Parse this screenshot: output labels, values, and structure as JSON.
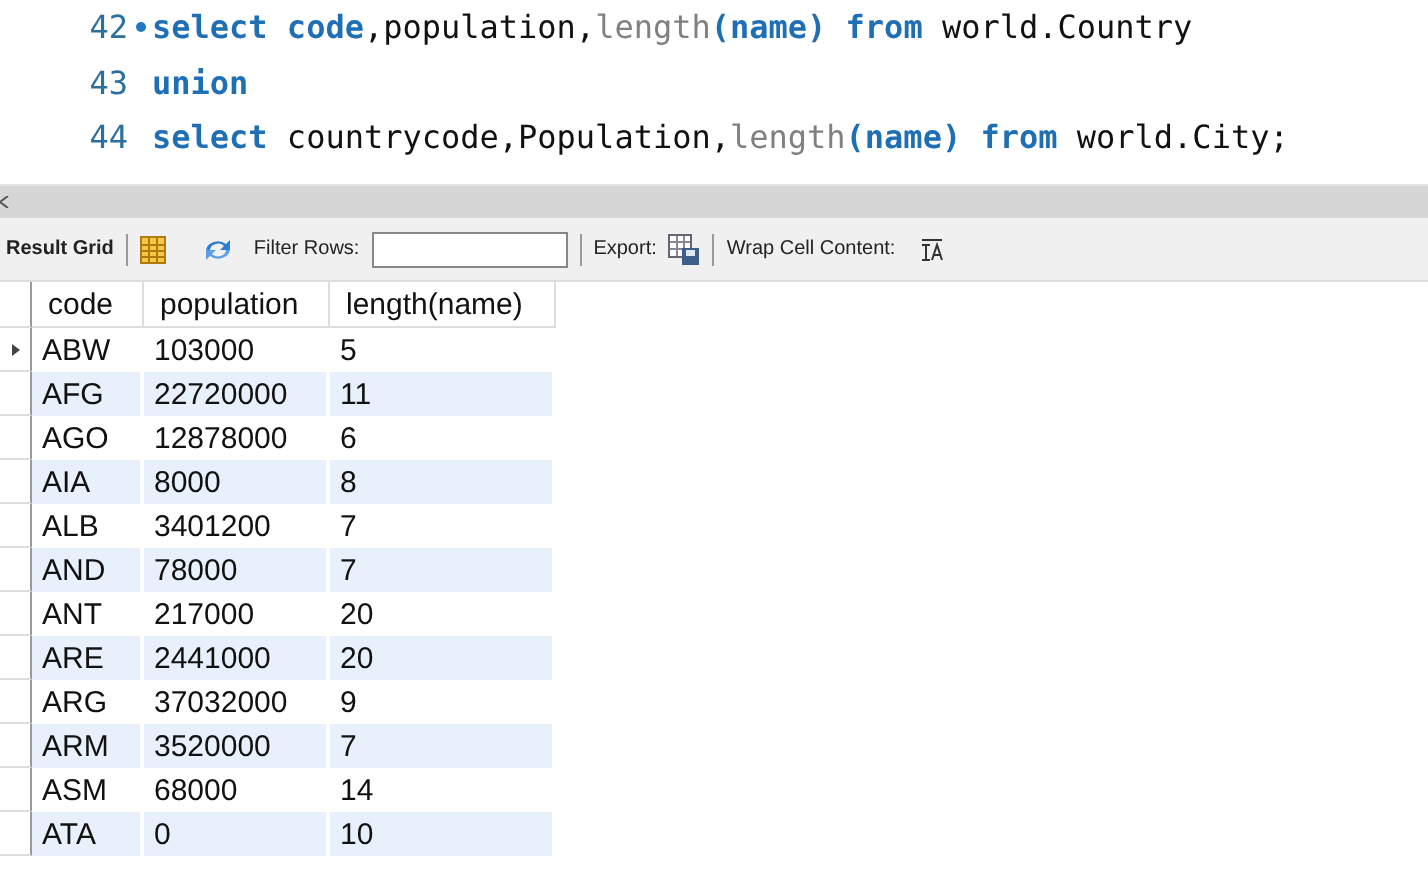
{
  "editor": {
    "lines": [
      {
        "number": "42",
        "marker": true,
        "tokens": [
          {
            "kind": "keyword",
            "text": "select code"
          },
          {
            "kind": "plain",
            "text": ",population,"
          },
          {
            "kind": "function",
            "text": "length"
          },
          {
            "kind": "keyword",
            "text": "(name) from"
          },
          {
            "kind": "plain",
            "text": " world.Country"
          }
        ]
      },
      {
        "number": "43",
        "marker": false,
        "tokens": [
          {
            "kind": "keyword",
            "text": "union"
          }
        ]
      },
      {
        "number": "44",
        "marker": false,
        "tokens": [
          {
            "kind": "keyword",
            "text": "select"
          },
          {
            "kind": "plain",
            "text": " countrycode,Population,"
          },
          {
            "kind": "function",
            "text": "length"
          },
          {
            "kind": "keyword",
            "text": "(name) from"
          },
          {
            "kind": "plain",
            "text": " world.City;"
          }
        ]
      }
    ]
  },
  "toolbar": {
    "result_grid": "Result Grid",
    "filter_label": "Filter Rows:",
    "export_label": "Export:",
    "wrap_label": "Wrap Cell Content:"
  },
  "table": {
    "columns": [
      "code",
      "population",
      "length(name)"
    ],
    "rows": [
      {
        "current": true,
        "cells": [
          "ABW",
          "103000",
          "5"
        ]
      },
      {
        "current": false,
        "cells": [
          "AFG",
          "22720000",
          "11"
        ]
      },
      {
        "current": false,
        "cells": [
          "AGO",
          "12878000",
          "6"
        ]
      },
      {
        "current": false,
        "cells": [
          "AIA",
          "8000",
          "8"
        ]
      },
      {
        "current": false,
        "cells": [
          "ALB",
          "3401200",
          "7"
        ]
      },
      {
        "current": false,
        "cells": [
          "AND",
          "78000",
          "7"
        ]
      },
      {
        "current": false,
        "cells": [
          "ANT",
          "217000",
          "20"
        ]
      },
      {
        "current": false,
        "cells": [
          "ARE",
          "2441000",
          "20"
        ]
      },
      {
        "current": false,
        "cells": [
          "ARG",
          "37032000",
          "9"
        ]
      },
      {
        "current": false,
        "cells": [
          "ARM",
          "3520000",
          "7"
        ]
      },
      {
        "current": false,
        "cells": [
          "ASM",
          "68000",
          "14"
        ]
      },
      {
        "current": false,
        "cells": [
          "ATA",
          "0",
          "10"
        ]
      }
    ]
  }
}
